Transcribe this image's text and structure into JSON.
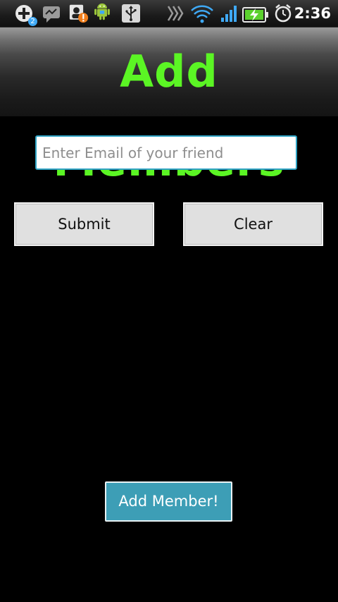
{
  "status_bar": {
    "time": "2:36",
    "notification_count": "2",
    "icons": [
      "add-notification-icon",
      "messenger-icon",
      "contact-alert-icon",
      "android-icon",
      "usb-icon",
      "sync-icon",
      "wifi-icon",
      "signal-icon",
      "battery-charging-icon",
      "alarm-icon"
    ]
  },
  "header": {
    "title": "Add Members"
  },
  "form": {
    "email_placeholder": "Enter Email of your friend",
    "email_value": ""
  },
  "buttons": {
    "submit": "Submit",
    "clear": "Clear",
    "add_member": "Add Member!"
  },
  "colors": {
    "title_green": "#5bf524",
    "input_border": "#2fa3c4",
    "add_button": "#3d9eb6",
    "background": "#000000"
  }
}
